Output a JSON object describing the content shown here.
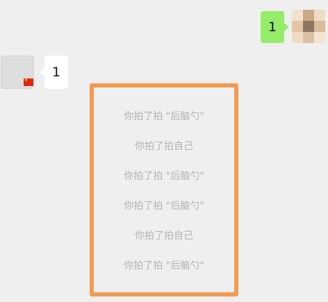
{
  "messages": {
    "outgoing": {
      "text": "1"
    },
    "incoming": {
      "text": "1"
    }
  },
  "system_tips": [
    "你拍了拍 \"后脑勺\"",
    "你拍了拍自己",
    "你拍了拍 \"后脑勺\"",
    "你拍了拍 \"后脑勺\"",
    "你拍了拍自己",
    "你拍了拍 \"后脑勺\""
  ],
  "colors": {
    "chat_background": "#efefef",
    "outgoing_bubble": "#95ec69",
    "incoming_bubble": "#ffffff",
    "highlight_border": "#f39a52",
    "tip_text": "#b3b3b3"
  },
  "icons": {
    "right_avatar": "blurred-avatar-icon",
    "left_avatar": "gray-avatar-icon",
    "left_badge": "china-flag-icon"
  }
}
